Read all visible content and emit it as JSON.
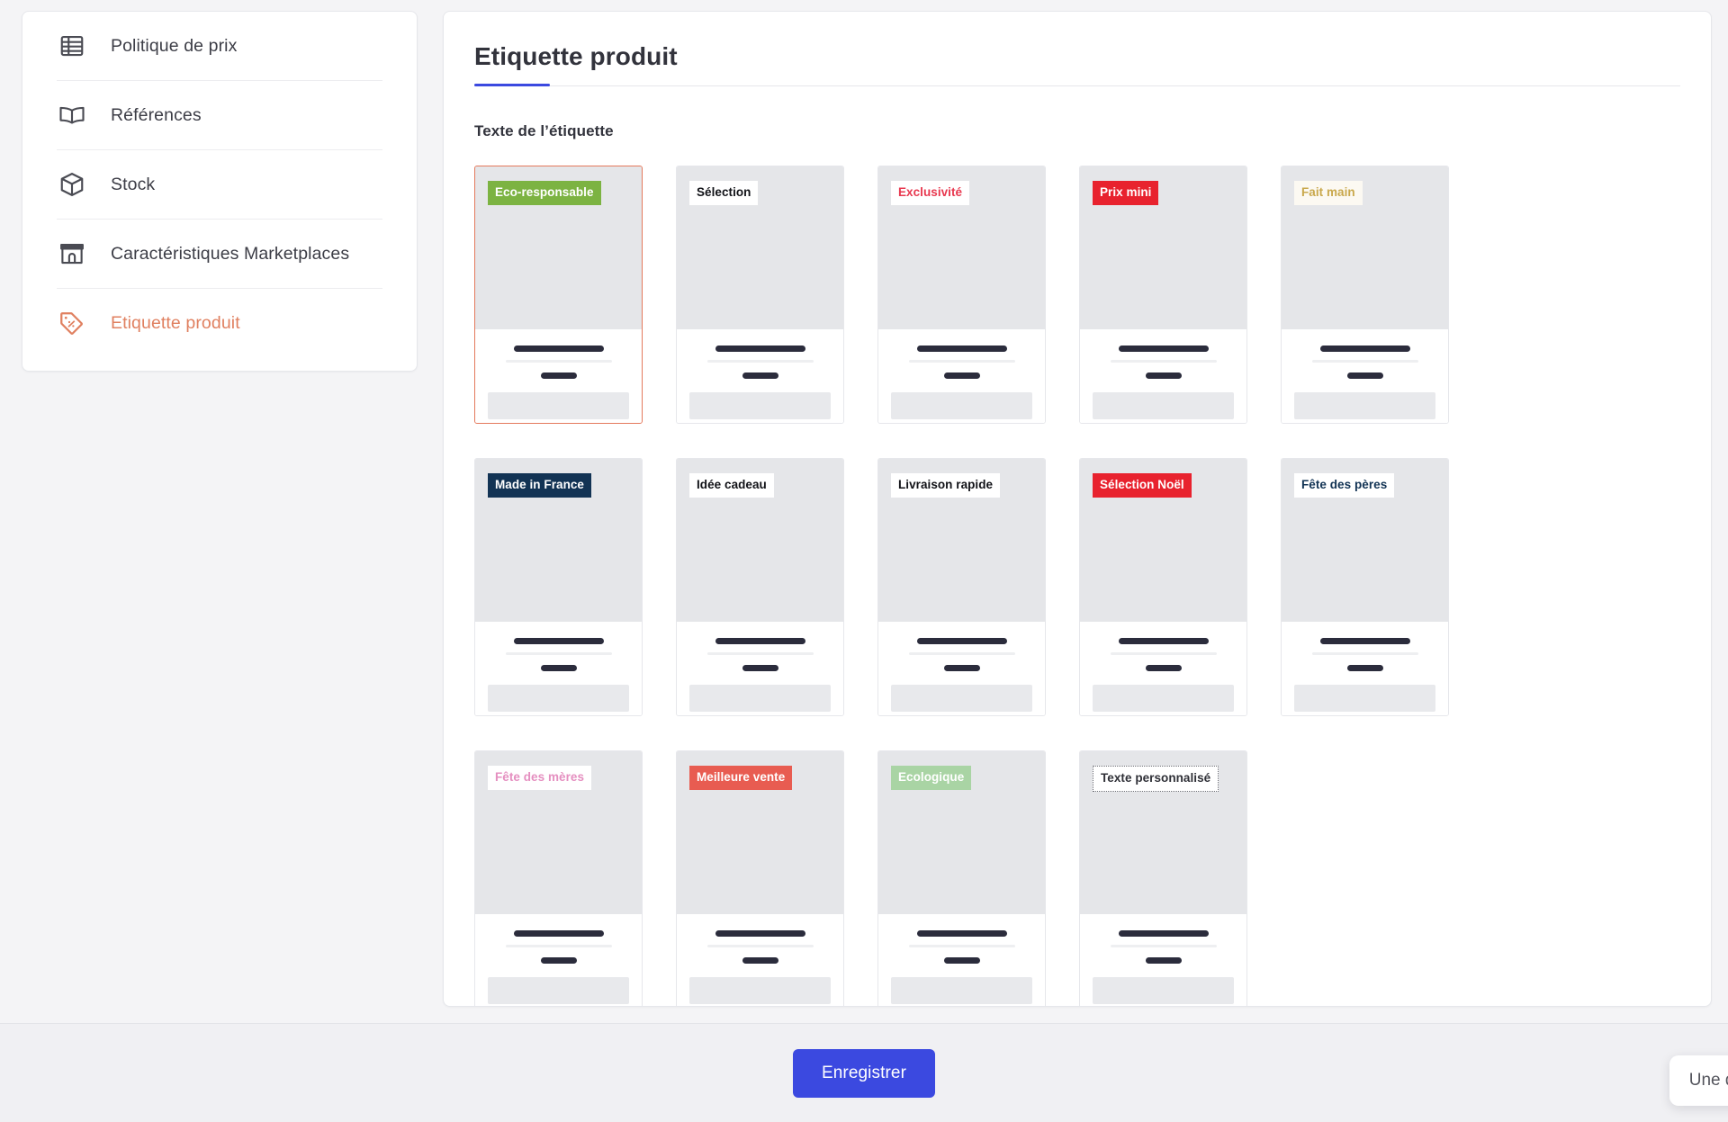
{
  "sidebar": {
    "items": [
      {
        "label": "Politique de prix",
        "icon": "price-policy-icon",
        "active": false
      },
      {
        "label": "Références",
        "icon": "book-icon",
        "active": false
      },
      {
        "label": "Stock",
        "icon": "box-icon",
        "active": false
      },
      {
        "label": "Caractéristiques Marketplaces",
        "icon": "storefront-icon",
        "active": false
      },
      {
        "label": "Etiquette produit",
        "icon": "price-tag-icon",
        "active": true
      }
    ]
  },
  "main": {
    "title": "Etiquette produit",
    "section_label": "Texte de l’étiquette",
    "accent_color": "#3b49e0",
    "selected_color": "#e4795c"
  },
  "labels": [
    {
      "text": "Eco-responsable",
      "bg": "#7cb342",
      "color": "#ffffff",
      "border": "none",
      "selected": true
    },
    {
      "text": "Sélection",
      "bg": "#ffffff",
      "color": "#111217",
      "border": "none",
      "selected": false
    },
    {
      "text": "Exclusivité",
      "bg": "#ffffff",
      "color": "#e8384f",
      "border": "none",
      "selected": false
    },
    {
      "text": "Prix mini",
      "bg": "#e8222e",
      "color": "#ffffff",
      "border": "none",
      "selected": false
    },
    {
      "text": "Fait main",
      "bg": "#fcf9f2",
      "color": "#c9a84c",
      "border": "none",
      "selected": false
    },
    {
      "text": "Made in France",
      "bg": "#123354",
      "color": "#ffffff",
      "border": "none",
      "selected": false
    },
    {
      "text": "Idée cadeau",
      "bg": "#ffffff",
      "color": "#111217",
      "border": "none",
      "selected": false
    },
    {
      "text": "Livraison rapide",
      "bg": "#ffffff",
      "color": "#111217",
      "border": "none",
      "selected": false
    },
    {
      "text": "Sélection Noël",
      "bg": "#e8222e",
      "color": "#ffffff",
      "border": "none",
      "selected": false
    },
    {
      "text": "Fête des pères",
      "bg": "#ffffff",
      "color": "#123354",
      "border": "none",
      "selected": false
    },
    {
      "text": "Fête des mères",
      "bg": "#ffffff",
      "color": "#e58fc0",
      "border": "none",
      "selected": false
    },
    {
      "text": "Meilleure vente",
      "bg": "#e85c51",
      "color": "#ffffff",
      "border": "none",
      "selected": false
    },
    {
      "text": "Ecologique",
      "bg": "#a9d4a4",
      "color": "#ffffff",
      "border": "none",
      "selected": false
    },
    {
      "text": "Texte personnalisé",
      "bg": "#ffffff",
      "color": "#2f3037",
      "border": "1px dotted #6c6d75",
      "selected": false
    }
  ],
  "footer": {
    "save_label": "Enregistrer",
    "chat_label": "Une qu"
  }
}
